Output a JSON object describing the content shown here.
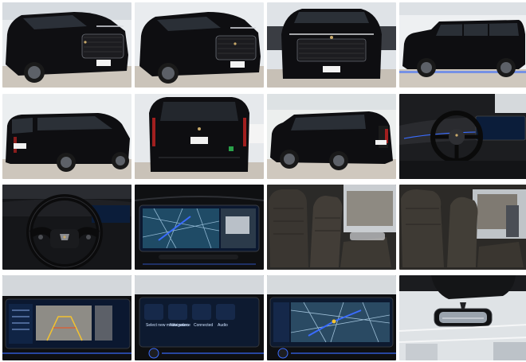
{
  "gallery": {
    "photos": [
      {
        "icon": "front-three-quarter-view-icon"
      },
      {
        "icon": "front-three-quarter-view-icon"
      },
      {
        "icon": "front-view-icon"
      },
      {
        "icon": "side-profile-icon"
      },
      {
        "icon": "rear-three-quarter-view-icon"
      },
      {
        "icon": "rear-view-icon"
      },
      {
        "icon": "rear-side-view-icon"
      },
      {
        "icon": "dashboard-icon"
      },
      {
        "icon": "steering-wheel-icon"
      },
      {
        "icon": "navigation-display-icon"
      },
      {
        "icon": "front-seats-icon"
      },
      {
        "icon": "rear-seats-icon"
      },
      {
        "icon": "backup-camera-icon"
      },
      {
        "icon": "infotainment-menu-icon"
      },
      {
        "icon": "navigation-map-icon"
      },
      {
        "icon": "rearview-mirror-icon"
      }
    ],
    "screen_text": {
      "menu_1": "Select new media source",
      "menu_2": "Navigation",
      "menu_3": "Connected",
      "menu_4": "Audio"
    }
  },
  "colors": {
    "paint": "#0d0d0f",
    "chrome": "#b9bcc2",
    "floor": "#c9c3ba",
    "wall": "#e9ecef",
    "screen": "#0b1d3a",
    "ambient": "#3a6cff"
  }
}
